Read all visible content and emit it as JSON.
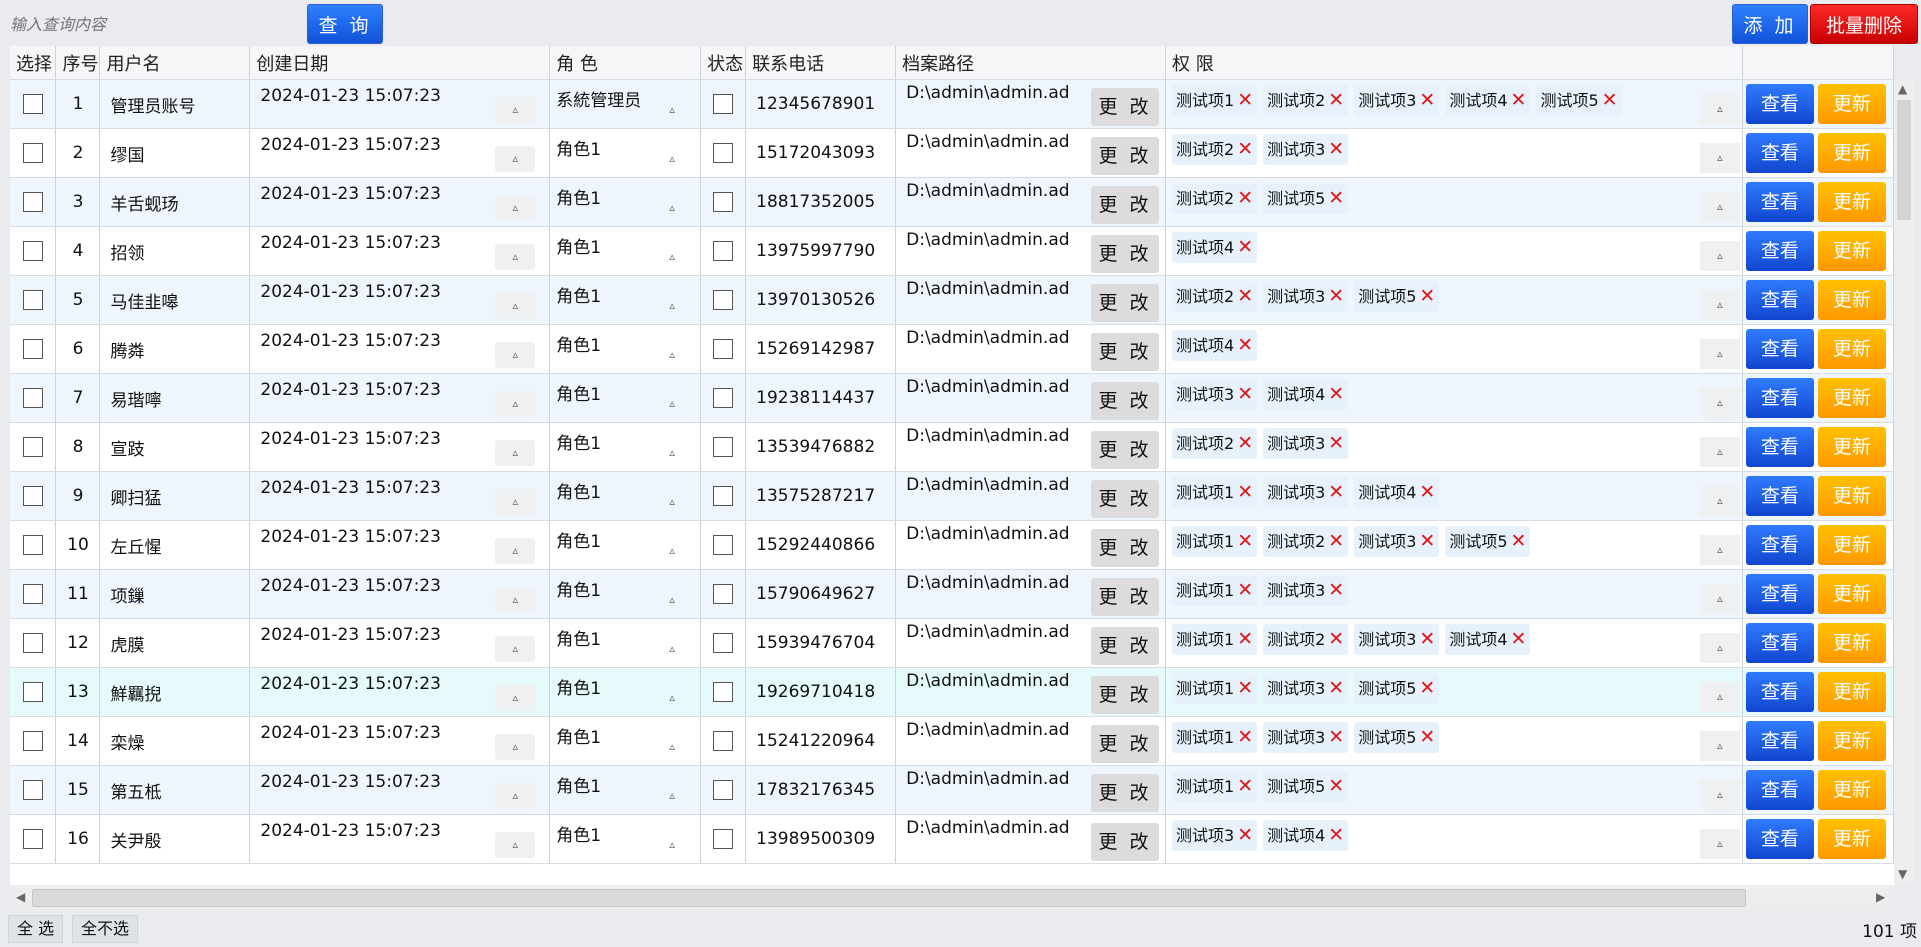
{
  "toolbar": {
    "search_placeholder": "输入查询内容",
    "query_label": "查 询",
    "add_label": "添 加",
    "batch_delete_label": "批量删除"
  },
  "columns": [
    "选择",
    "序号",
    "用户名",
    "创建日期",
    "角 色",
    "状态",
    "联系电话",
    "档案路径",
    "权 限"
  ],
  "change_label": "更 改",
  "view_label": "查看",
  "update_label": "更新",
  "rows": [
    {
      "idx": "1",
      "name": "管理员账号",
      "date": "2024-01-23 15:07:23",
      "role": "系統管理员",
      "phone": "12345678901",
      "path": "D:\\admin\\admin.ad",
      "perms": [
        "测试项1",
        "测试项2",
        "测试项3",
        "测试项4",
        "测试项5"
      ]
    },
    {
      "idx": "2",
      "name": "缪国",
      "date": "2024-01-23 15:07:23",
      "role": "角色1",
      "phone": "15172043093",
      "path": "D:\\admin\\admin.ad",
      "perms": [
        "测试项2",
        "测试项3"
      ]
    },
    {
      "idx": "3",
      "name": "羊舌蚬玚",
      "date": "2024-01-23 15:07:23",
      "role": "角色1",
      "phone": "18817352005",
      "path": "D:\\admin\\admin.ad",
      "perms": [
        "测试项2",
        "测试项5"
      ]
    },
    {
      "idx": "4",
      "name": "招领",
      "date": "2024-01-23 15:07:23",
      "role": "角色1",
      "phone": "13975997790",
      "path": "D:\\admin\\admin.ad",
      "perms": [
        "测试项4"
      ]
    },
    {
      "idx": "5",
      "name": "马佳韭嗥",
      "date": "2024-01-23 15:07:23",
      "role": "角色1",
      "phone": "13970130526",
      "path": "D:\\admin\\admin.ad",
      "perms": [
        "测试项2",
        "测试项3",
        "测试项5"
      ]
    },
    {
      "idx": "6",
      "name": "腾粦",
      "date": "2024-01-23 15:07:23",
      "role": "角色1",
      "phone": "15269142987",
      "path": "D:\\admin\\admin.ad",
      "perms": [
        "测试项4"
      ]
    },
    {
      "idx": "7",
      "name": "易瑎嚀",
      "date": "2024-01-23 15:07:23",
      "role": "角色1",
      "phone": "19238114437",
      "path": "D:\\admin\\admin.ad",
      "perms": [
        "测试项3",
        "测试项4"
      ]
    },
    {
      "idx": "8",
      "name": "宣跂",
      "date": "2024-01-23 15:07:23",
      "role": "角色1",
      "phone": "13539476882",
      "path": "D:\\admin\\admin.ad",
      "perms": [
        "测试项2",
        "测试项3"
      ]
    },
    {
      "idx": "9",
      "name": "卿扫猛",
      "date": "2024-01-23 15:07:23",
      "role": "角色1",
      "phone": "13575287217",
      "path": "D:\\admin\\admin.ad",
      "perms": [
        "测试项1",
        "测试项3",
        "测试项4"
      ]
    },
    {
      "idx": "10",
      "name": "左丘惺",
      "date": "2024-01-23 15:07:23",
      "role": "角色1",
      "phone": "15292440866",
      "path": "D:\\admin\\admin.ad",
      "perms": [
        "测试项1",
        "测试项2",
        "测试项3",
        "测试项5"
      ]
    },
    {
      "idx": "11",
      "name": "项鏁",
      "date": "2024-01-23 15:07:23",
      "role": "角色1",
      "phone": "15790649627",
      "path": "D:\\admin\\admin.ad",
      "perms": [
        "测试项1",
        "测试项3"
      ]
    },
    {
      "idx": "12",
      "name": "虎膜",
      "date": "2024-01-23 15:07:23",
      "role": "角色1",
      "phone": "15939476704",
      "path": "D:\\admin\\admin.ad",
      "perms": [
        "测试项1",
        "测试项2",
        "测试项3",
        "测试项4"
      ]
    },
    {
      "idx": "13",
      "name": "鮮羈掜",
      "date": "2024-01-23 15:07:23",
      "role": "角色1",
      "phone": "19269710418",
      "path": "D:\\admin\\admin.ad",
      "perms": [
        "测试项1",
        "测试项3",
        "测试项5"
      ]
    },
    {
      "idx": "14",
      "name": "栾燥",
      "date": "2024-01-23 15:07:23",
      "role": "角色1",
      "phone": "15241220964",
      "path": "D:\\admin\\admin.ad",
      "perms": [
        "测试项1",
        "测试项3",
        "测试项5"
      ]
    },
    {
      "idx": "15",
      "name": "第五柢",
      "date": "2024-01-23 15:07:23",
      "role": "角色1",
      "phone": "17832176345",
      "path": "D:\\admin\\admin.ad",
      "perms": [
        "测试项1",
        "测试项5"
      ]
    },
    {
      "idx": "16",
      "name": "关尹殷",
      "date": "2024-01-23 15:07:23",
      "role": "角色1",
      "phone": "13989500309",
      "path": "D:\\admin\\admin.ad",
      "perms": [
        "测试项3",
        "测试项4"
      ]
    }
  ],
  "footer": {
    "select_all": "全 选",
    "select_none": "全不选",
    "count": "101 项"
  }
}
